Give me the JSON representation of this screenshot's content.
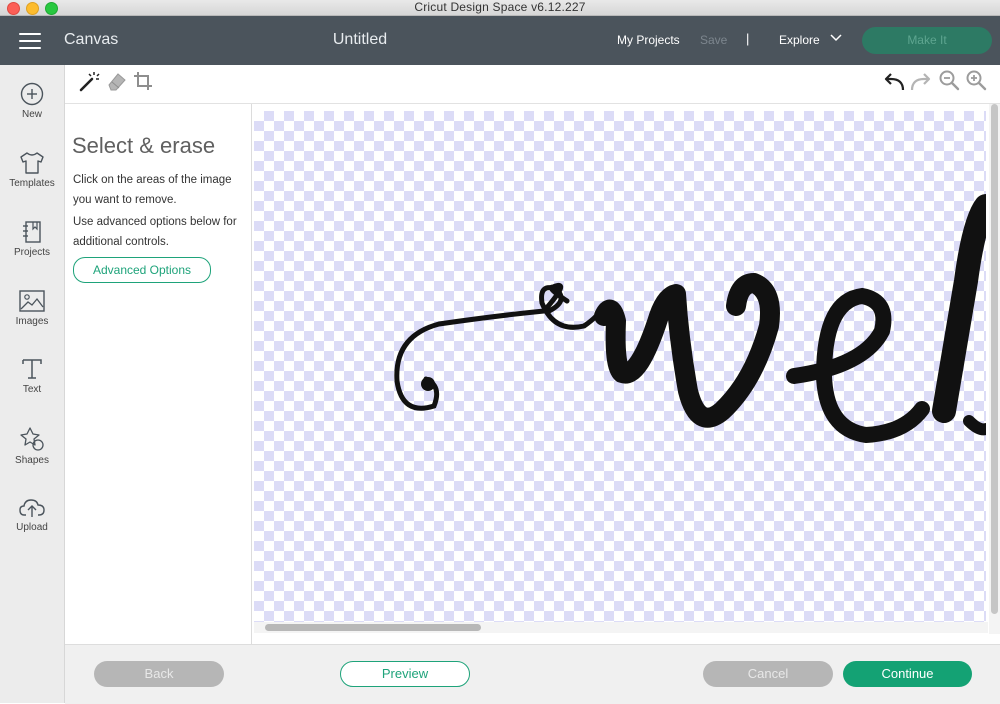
{
  "window": {
    "title": "Cricut Design Space  v6.12.227"
  },
  "header": {
    "section": "Canvas",
    "project_title": "Untitled",
    "my_projects": "My Projects",
    "save": "Save",
    "separator": "|",
    "explore": "Explore",
    "make_it": "Make It"
  },
  "nav": {
    "items": [
      {
        "label": "New",
        "icon": "plus-circle-icon"
      },
      {
        "label": "Templates",
        "icon": "shirt-icon"
      },
      {
        "label": "Projects",
        "icon": "notebook-icon"
      },
      {
        "label": "Images",
        "icon": "image-icon"
      },
      {
        "label": "Text",
        "icon": "text-icon"
      },
      {
        "label": "Shapes",
        "icon": "shapes-icon"
      },
      {
        "label": "Upload",
        "icon": "cloud-upload-icon"
      }
    ]
  },
  "toolbar": {
    "tools": [
      "magic-wand-icon",
      "eraser-icon",
      "crop-icon"
    ],
    "actions": [
      "undo-icon",
      "redo-icon",
      "zoom-out-icon",
      "zoom-in-icon"
    ]
  },
  "panel": {
    "title": "Select & erase",
    "instruction_1": "Click on the areas of the image you want to remove.",
    "instruction_2": "Use advanced options below for additional controls.",
    "advanced_button": "Advanced Options"
  },
  "footer": {
    "back": "Back",
    "preview": "Preview",
    "cancel": "Cancel",
    "continue": "Continue"
  },
  "colors": {
    "header_bg": "#4b545c",
    "accent_green": "#14a274",
    "checker": "#dcdcf7"
  }
}
